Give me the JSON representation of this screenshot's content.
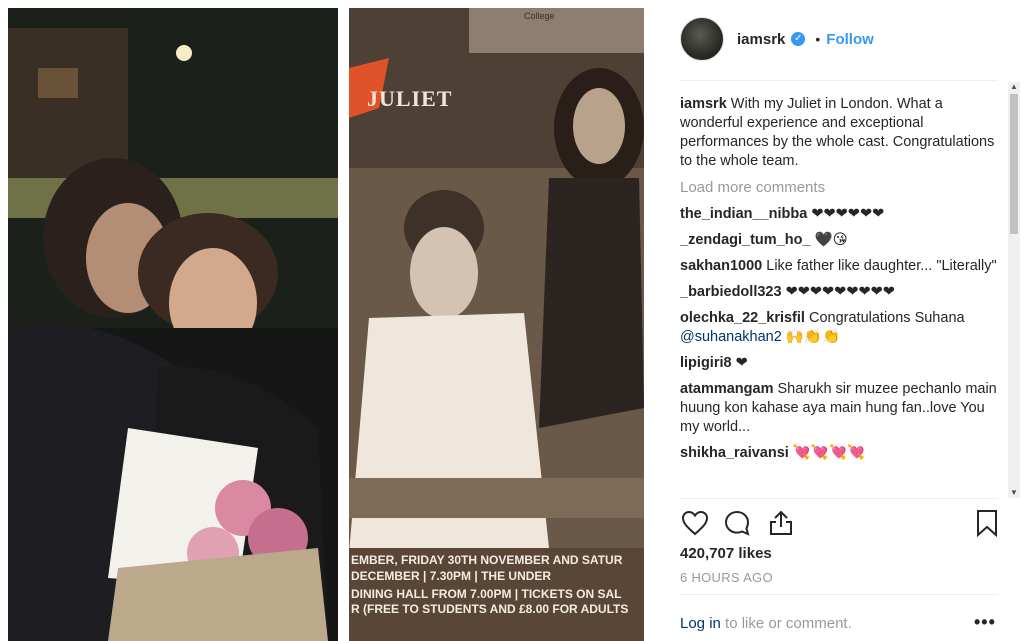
{
  "photo": {
    "left_alt": "man and daughter with flowers",
    "poster_brand": "JULIET",
    "poster_sign": "College",
    "poster_line1": "EMBER, FRIDAY 30TH NOVEMBER AND SATUR",
    "poster_line2": "DECEMBER | 7.30PM | THE UNDER",
    "poster_line3": "DINING HALL FROM 7.00PM | TICKETS ON SAL",
    "poster_line4": "R (FREE TO STUDENTS AND £8.00 FOR ADULTS"
  },
  "header": {
    "username": "iamsrk",
    "follow_label": "Follow"
  },
  "caption": {
    "username": "iamsrk",
    "text": "With my Juliet in London. What a wonderful experience and exceptional performances by the whole cast. Congratulations to the whole team."
  },
  "load_more": "Load more comments",
  "comments": [
    {
      "user": "the_indian__nibba",
      "text": "❤❤❤❤❤❤"
    },
    {
      "user": "_zendagi_tum_ho_",
      "text": "🖤😘"
    },
    {
      "user": "sakhan1000",
      "text": "Like father like daughter... \"Literally\""
    },
    {
      "user": "_barbiedoll323",
      "text": "❤❤❤❤❤❤❤❤❤"
    },
    {
      "user": "olechka_22_krisfil",
      "text": "Congratulations Suhana",
      "mention": "@suhanakhan2",
      "after": "🙌👏👏"
    },
    {
      "user": "lipigiri8",
      "text": "❤"
    },
    {
      "user": "atammangam",
      "text": "Sharukh sir muzee pechanlo main huung kon kahase aya main hung fan..love You my world..."
    },
    {
      "user": "shikha_raivansi",
      "text": "💘💘💘💘"
    }
  ],
  "likes": "420,707 likes",
  "time": "6 HOURS AGO",
  "login": {
    "link": "Log in",
    "rest": " to like or comment."
  },
  "colors": {
    "accent": "#3897f0",
    "heart": "#e0142b",
    "muted": "#999999"
  },
  "icons": [
    "heart-icon",
    "comment-icon",
    "share-icon",
    "bookmark-icon",
    "more-icon",
    "verified-icon"
  ]
}
